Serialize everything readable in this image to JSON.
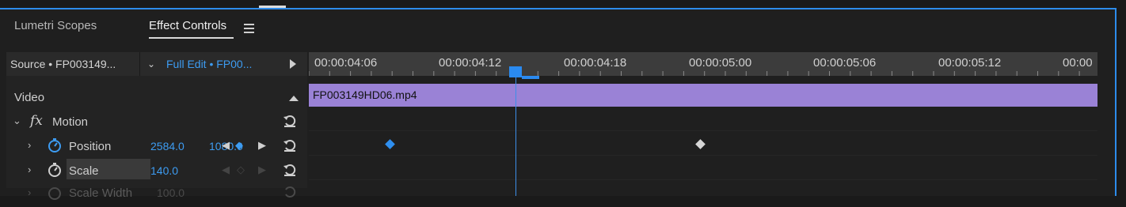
{
  "tabs": {
    "lumetri_scopes": "Lumetri Scopes",
    "effect_controls": "Effect Controls"
  },
  "source_row": {
    "source_label": "Source • FP003149...",
    "sequence_label": "Full Edit • FP00..."
  },
  "sections": {
    "video": "Video",
    "motion": "Motion",
    "fx_icon": "fx"
  },
  "properties": [
    {
      "name": "Position",
      "value_x": "2584.0",
      "value_y": "1080.0",
      "animated": true
    },
    {
      "name": "Scale",
      "value": "140.0",
      "animated": false
    },
    {
      "name": "Scale Width",
      "value": "100.0",
      "disabled": true
    }
  ],
  "timeline": {
    "timecodes": [
      "00:00:04:06",
      "00:00:04:12",
      "00:00:04:18",
      "00:00:05:00",
      "00:00:05:06",
      "00:00:05:12",
      "00:00"
    ],
    "clip_name": "FP003149HD06.mp4"
  },
  "colors": {
    "accent": "#2d8ceb",
    "clip": "#9a82d6",
    "value_text": "#3d9cf2"
  },
  "icons": [
    "hamburger-menu-icon",
    "chevron-down-icon",
    "play-icon",
    "collapse-up-icon",
    "chevron-right-icon",
    "stopwatch-icon",
    "reset-parameter-icon",
    "keyframe-icon",
    "playhead-icon"
  ]
}
